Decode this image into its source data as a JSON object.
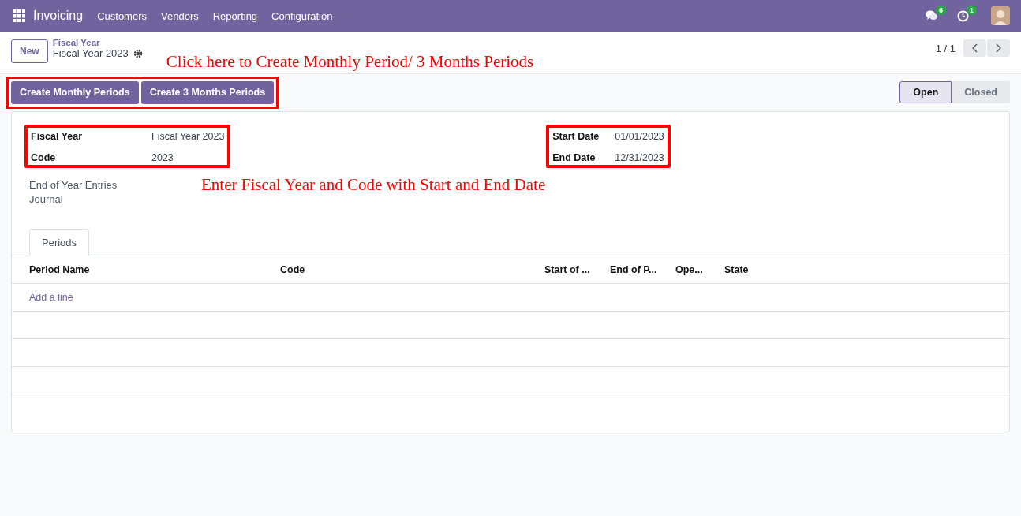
{
  "navbar": {
    "app_name": "Invoicing",
    "menus": [
      "Customers",
      "Vendors",
      "Reporting",
      "Configuration"
    ],
    "messages_count": "6",
    "activities_count": "1"
  },
  "control_panel": {
    "new_button": "New",
    "breadcrumb_parent": "Fiscal Year",
    "breadcrumb_current": "Fiscal Year 2023",
    "pager": "1 / 1"
  },
  "annotations": [
    "Click here to Create Monthly Period/ 3 Months Periods",
    "Enter Fiscal Year and Code with Start and End Date"
  ],
  "action_buttons": [
    "Create Monthly Periods",
    "Create 3 Months Periods"
  ],
  "status_bar": [
    {
      "label": "Open",
      "selected": true
    },
    {
      "label": "Closed",
      "selected": false
    }
  ],
  "form": {
    "left_fields": [
      {
        "label": "Fiscal Year",
        "value": "Fiscal Year 2023"
      },
      {
        "label": "Code",
        "value": "2023"
      }
    ],
    "right_fields": [
      {
        "label": "Start Date",
        "value": "01/01/2023"
      },
      {
        "label": "End Date",
        "value": "12/31/2023"
      }
    ],
    "extra_field": {
      "label": "End of Year Entries Journal"
    }
  },
  "tabs": [
    {
      "label": "Periods",
      "selected": true
    }
  ],
  "table": {
    "columns": [
      "Period Name",
      "Code",
      "Start of ...",
      "End of P...",
      "Ope...",
      "State"
    ],
    "add_line": "Add a line"
  }
}
